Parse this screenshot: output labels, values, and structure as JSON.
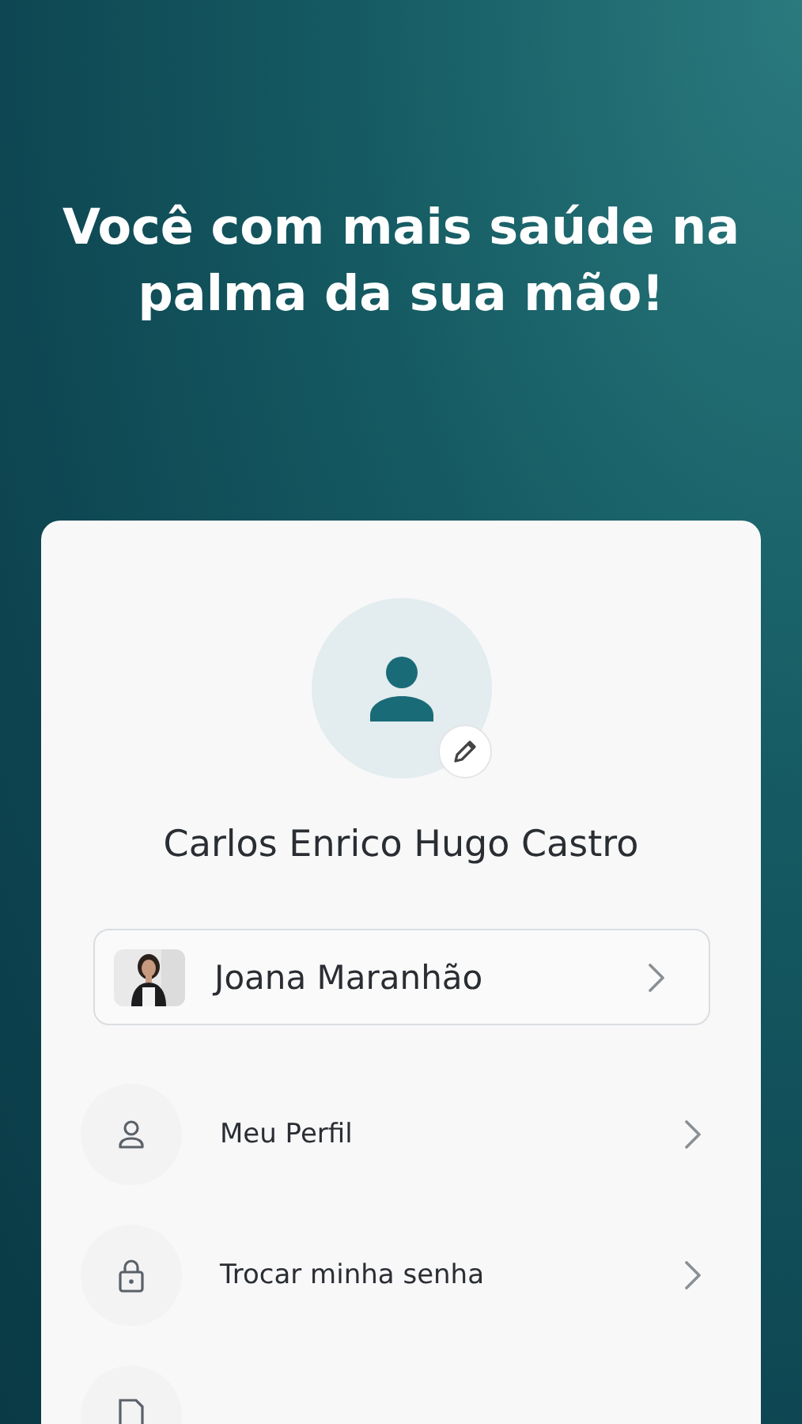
{
  "headline": "Você com mais saúde na palma da sua mão!",
  "profile": {
    "name": "Carlos Enrico Hugo Castro"
  },
  "dependent": {
    "name": "Joana Maranhão"
  },
  "menu": [
    {
      "label": "Meu Perfil",
      "kind": "person"
    },
    {
      "label": "Trocar minha senha",
      "kind": "lock"
    },
    {
      "kind": "document"
    }
  ]
}
